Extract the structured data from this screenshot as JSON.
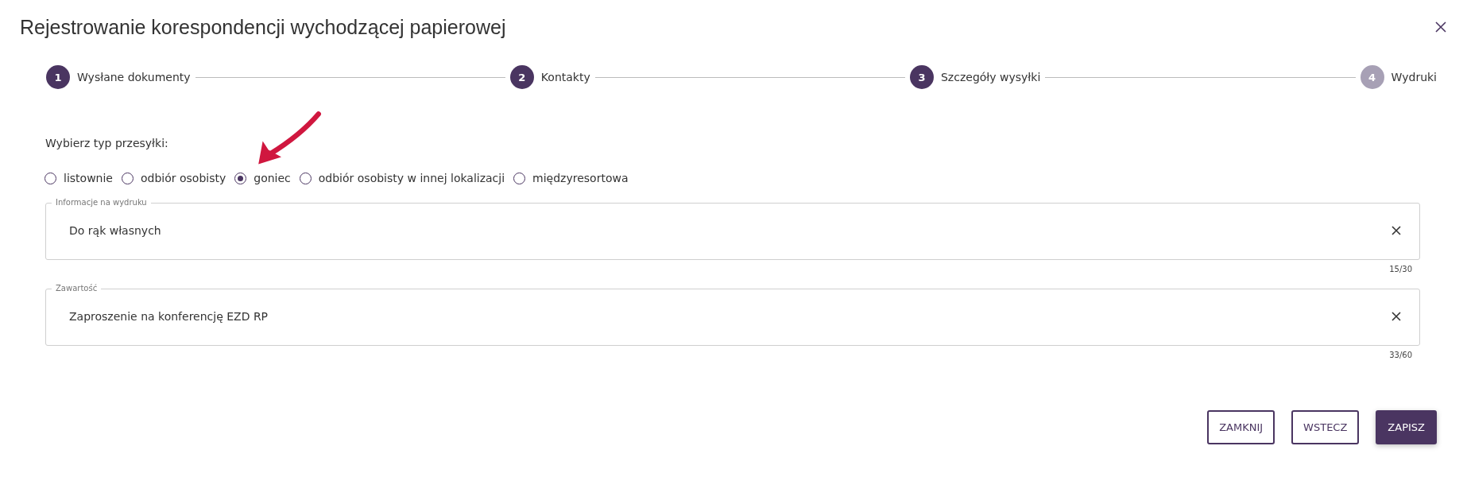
{
  "dialog": {
    "title": "Rejestrowanie korespondencji wychodzącej papierowej"
  },
  "steps": [
    {
      "number": "1",
      "label": "Wysłane dokumenty",
      "reached": true
    },
    {
      "number": "2",
      "label": "Kontakty",
      "reached": true
    },
    {
      "number": "3",
      "label": "Szczegóły wysyłki",
      "reached": true
    },
    {
      "number": "4",
      "label": "Wydruki",
      "reached": false
    }
  ],
  "shipping_type": {
    "label": "Wybierz typ przesyłki:",
    "options": [
      {
        "label": "listownie",
        "selected": false
      },
      {
        "label": "odbiór osobisty",
        "selected": false
      },
      {
        "label": "goniec",
        "selected": true
      },
      {
        "label": "odbiór osobisty w innej lokalizacji",
        "selected": false
      },
      {
        "label": "międzyresortowa",
        "selected": false
      }
    ]
  },
  "fields": [
    {
      "label": "Informacje na wydruku",
      "value": "Do rąk własnych",
      "counter": "15/30"
    },
    {
      "label": "Zawartość",
      "value": "Zaproszenie na konferencję EZD RP",
      "counter": "33/60"
    }
  ],
  "buttons": [
    {
      "label": "ZAMKNIJ",
      "kind": "outline"
    },
    {
      "label": "WSTECZ",
      "kind": "outline"
    },
    {
      "label": "ZAPISZ",
      "kind": "primary"
    }
  ]
}
